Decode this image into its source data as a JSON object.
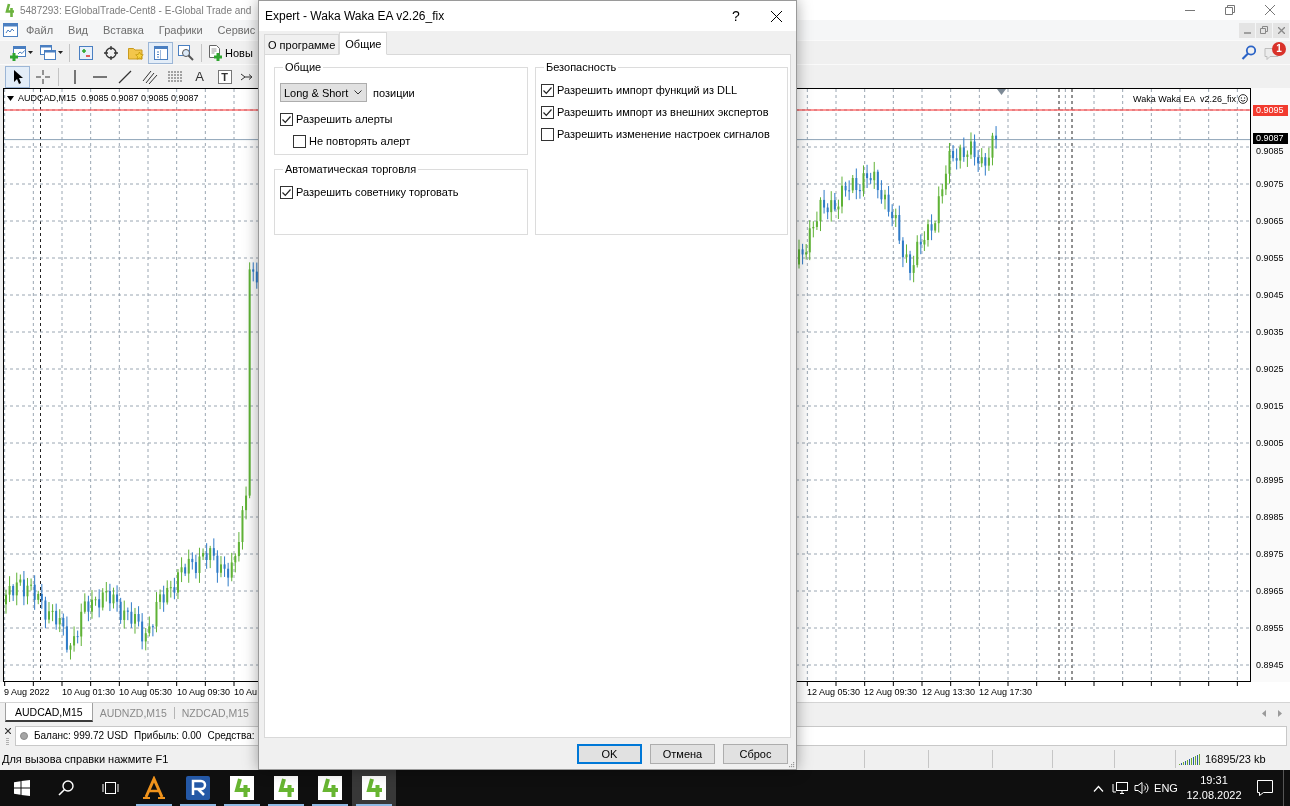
{
  "app_window": {
    "title": "5487293: EGlobalTrade-Cent8 - E-Global Trade and"
  },
  "menu": [
    {
      "label": "Файл"
    },
    {
      "label": "Вид"
    },
    {
      "label": "Вставка"
    },
    {
      "label": "Графики"
    },
    {
      "label": "Сервис"
    }
  ],
  "toolbar": {
    "groups": [
      [
        {
          "kind": "new-chart",
          "pressed": false
        },
        {
          "kind": "profiles",
          "pressed": false
        }
      ],
      [
        {
          "kind": "market-watch",
          "pressed": false
        },
        {
          "kind": "data-window",
          "pressed": false
        },
        {
          "kind": "navigator",
          "pressed": false
        },
        {
          "kind": "terminal",
          "pressed": true
        },
        {
          "kind": "tester",
          "pressed": false
        }
      ],
      [
        {
          "kind": "new-order",
          "label": "Новы",
          "pressed": false
        }
      ]
    ],
    "notifications": "1"
  },
  "drawing_toolbar": {
    "groups": [
      [
        {
          "kind": "cursor",
          "pressed": true
        },
        {
          "kind": "crosshair",
          "pressed": false
        }
      ],
      [
        {
          "kind": "vertical-line",
          "pressed": false
        },
        {
          "kind": "horizontal-line",
          "pressed": false
        },
        {
          "kind": "trend-line",
          "pressed": false
        },
        {
          "kind": "channel",
          "pressed": false
        },
        {
          "kind": "fibo",
          "pressed": false
        },
        {
          "kind": "text",
          "glyph": "A",
          "pressed": false
        },
        {
          "kind": "label",
          "glyph": "T",
          "pressed": false
        },
        {
          "kind": "arrows",
          "pressed": false
        }
      ]
    ]
  },
  "chart": {
    "header": "AUDCAD,M15  0.9085 0.9087 0.9085 0.9087",
    "expert_label": "Waka Waka EA  v2.26_fix",
    "level_tag": "0.9095",
    "bid_tag": "0.9087",
    "price_labels": [
      "0.9085",
      "0.9075",
      "0.9065",
      "0.9055",
      "0.9045",
      "0.9035",
      "0.9025",
      "0.9015",
      "0.9005",
      "0.8995",
      "0.8985",
      "0.8975",
      "0.8965",
      "0.8955",
      "0.8945"
    ],
    "time_labels": [
      "9 Aug 2022",
      "10 Aug 01:30",
      "10 Aug 05:30",
      "10 Aug 09:30",
      "10 Au",
      "12 Aug 05:30",
      "12 Aug 09:30",
      "12 Aug 13:30",
      "12 Aug 17:30"
    ]
  },
  "chart_tabs": [
    {
      "label": "AUDCAD,M15",
      "selected": true
    },
    {
      "label": "AUDNZD,M15",
      "selected": false
    },
    {
      "label": "NZDCAD,M15",
      "selected": false
    }
  ],
  "terminal": {
    "summary": [
      "Баланс: 999.72 USD",
      "Прибыль: 0.00",
      "Средства:"
    ]
  },
  "status_bar": {
    "help": "Для вызова справки нажмите F1",
    "traffic": "16895/23 kb"
  },
  "dialog": {
    "title": "Expert - Waka Waka EA v2.26_fix",
    "help_button": "?",
    "tabs": [
      {
        "label": "О программе",
        "selected": false
      },
      {
        "label": "Общие",
        "selected": true
      }
    ],
    "columns": [
      {
        "groups": [
          {
            "title": "Общие",
            "items": [
              {
                "kind": "select",
                "value": "Long & Short",
                "label": "позиции"
              },
              {
                "kind": "checkbox",
                "label": "Разрешить алерты",
                "checked": true,
                "children": [
                  {
                    "kind": "checkbox",
                    "label": "Не повторять алерт",
                    "checked": false
                  }
                ]
              }
            ]
          },
          {
            "title": "Автоматическая торговля",
            "items": [
              {
                "kind": "checkbox",
                "label": "Разрешить советнику торговать",
                "checked": true
              }
            ]
          }
        ]
      },
      {
        "groups": [
          {
            "title": "Безопасность",
            "items": [
              {
                "kind": "checkbox",
                "label": "Разрешить импорт функций из DLL",
                "checked": true
              },
              {
                "kind": "checkbox",
                "label": "Разрешить импорт из внешних экспертов",
                "checked": true
              },
              {
                "kind": "checkbox",
                "label": "Разрешить изменение настроек сигналов",
                "checked": false
              }
            ]
          }
        ]
      }
    ],
    "buttons": [
      {
        "label": "OK",
        "default": true
      },
      {
        "label": "Отмена",
        "default": false
      },
      {
        "label": "Сброс",
        "default": false
      }
    ]
  },
  "taskbar": {
    "apps": [
      {
        "kind": "a-logo",
        "running": true,
        "active": false
      },
      {
        "kind": "r-logo",
        "running": true,
        "active": false
      },
      {
        "kind": "mt4",
        "running": true,
        "active": false
      },
      {
        "kind": "mt4",
        "running": true,
        "active": false
      },
      {
        "kind": "mt4",
        "running": true,
        "active": false
      },
      {
        "kind": "mt4",
        "running": true,
        "active": true
      }
    ],
    "language": "ENG",
    "time": "19:31",
    "date": "12.08.2022"
  }
}
